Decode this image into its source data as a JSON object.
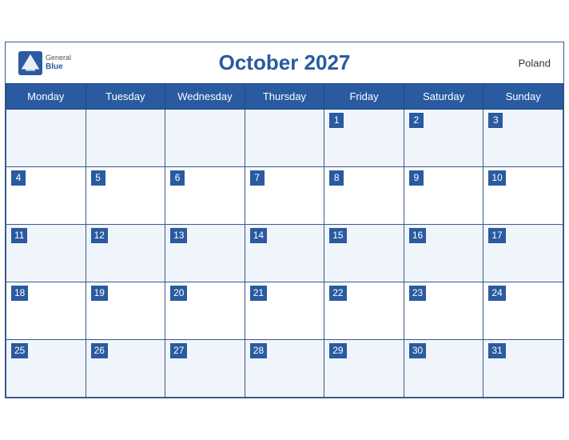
{
  "calendar": {
    "title": "October 2027",
    "country": "Poland",
    "days_of_week": [
      "Monday",
      "Tuesday",
      "Wednesday",
      "Thursday",
      "Friday",
      "Saturday",
      "Sunday"
    ],
    "weeks": [
      [
        null,
        null,
        null,
        null,
        1,
        2,
        3
      ],
      [
        4,
        5,
        6,
        7,
        8,
        9,
        10
      ],
      [
        11,
        12,
        13,
        14,
        15,
        16,
        17
      ],
      [
        18,
        19,
        20,
        21,
        22,
        23,
        24
      ],
      [
        25,
        26,
        27,
        28,
        29,
        30,
        31
      ]
    ],
    "logo": {
      "general": "General",
      "blue": "Blue"
    }
  }
}
